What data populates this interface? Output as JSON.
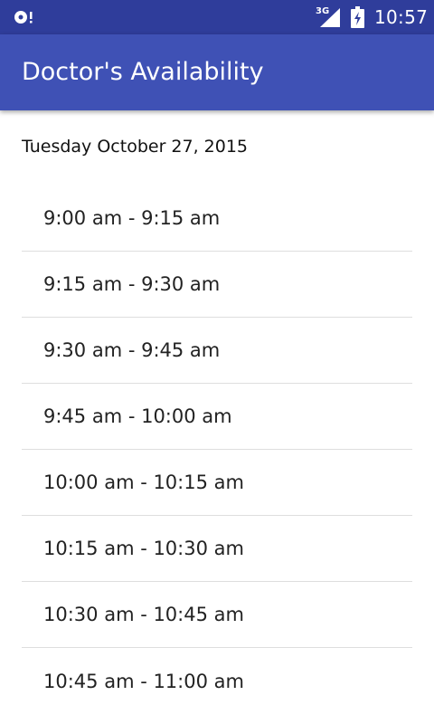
{
  "status_bar": {
    "network_type": "3G",
    "time": "10:57",
    "icons": [
      "notification-icon",
      "signal-icon",
      "battery-charging-icon"
    ]
  },
  "app_bar": {
    "title": "Doctor's Availability"
  },
  "content": {
    "date": "Tuesday October 27, 2015",
    "slots": [
      "9:00 am - 9:15 am",
      "9:15 am - 9:30 am",
      "9:30 am - 9:45 am",
      "9:45 am - 10:00 am",
      "10:00 am - 10:15 am",
      "10:15 am - 10:30 am",
      "10:30 am - 10:45 am",
      "10:45 am - 11:00 am"
    ]
  },
  "colors": {
    "status_bar": "#2f3d9b",
    "app_bar": "#3f51b5"
  }
}
